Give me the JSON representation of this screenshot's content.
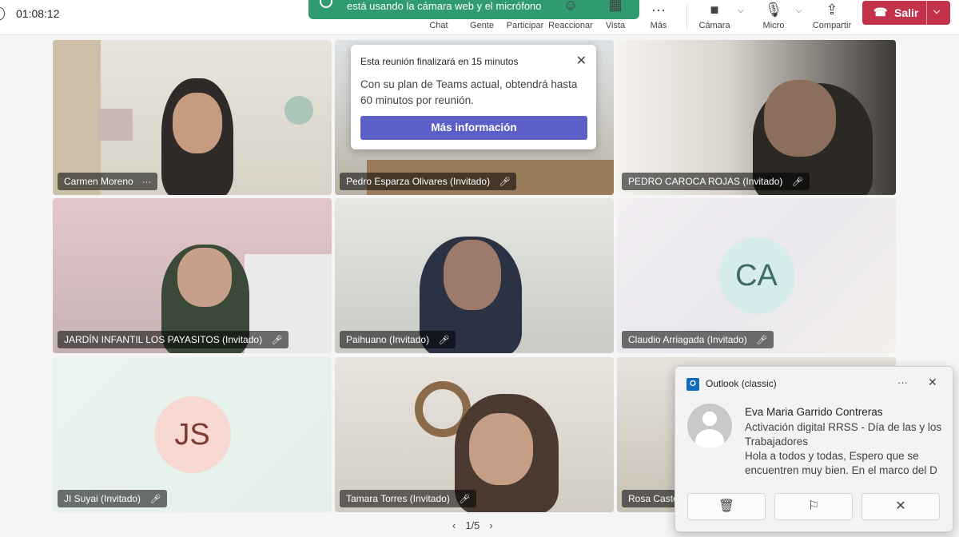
{
  "topbar": {
    "timer": "01:08:12",
    "banner_text": "está usando la cámara web y el micrófono",
    "buttons": [
      {
        "label": "Chat",
        "icon": "chat-icon"
      },
      {
        "label": "Gente",
        "icon": "people-icon"
      },
      {
        "label": "Participar",
        "icon": "raise-hand-icon"
      },
      {
        "label": "Reaccionar",
        "icon": "emoji-icon"
      },
      {
        "label": "Vista",
        "icon": "grid-icon"
      },
      {
        "label": "Más",
        "icon": "more-icon"
      },
      {
        "label": "Cámara",
        "icon": "camera-icon"
      },
      {
        "label": "Micro",
        "icon": "mic-icon"
      },
      {
        "label": "Compartir",
        "icon": "share-icon"
      }
    ],
    "leave_label": "Salir"
  },
  "tiles": [
    {
      "name": "Carmen Moreno",
      "muted": false,
      "more": "···"
    },
    {
      "name": "Pedro Esparza Olivares (Invitado)",
      "muted": true
    },
    {
      "name": "PEDRO CAROCA ROJAS (Invitado)",
      "muted": true
    },
    {
      "name": "JARDÍN INFANTIL LOS PAYASITOS (Invitado)",
      "muted": true
    },
    {
      "name": "Paihuano (Invitado)",
      "muted": true
    },
    {
      "name": "Claudio Arriagada (Invitado)",
      "muted": true,
      "initials": "CA"
    },
    {
      "name": "JI Suyai (Invitado)",
      "muted": true,
      "initials": "JS"
    },
    {
      "name": "Tamara Torres (Invitado)",
      "muted": true
    },
    {
      "name": "Rosa Castex",
      "muted": false
    }
  ],
  "meeting_notice": {
    "title": "Esta reunión finalizará en 15 minutos",
    "body": "Con su plan de Teams actual, obtendrá hasta 60 minutos por reunión.",
    "button": "Más información"
  },
  "toast": {
    "app": "Outlook (classic)",
    "more": "···",
    "sender": "Eva Maria Garrido Contreras",
    "subject": "Activación digital RRSS - Día de las y los Trabajadores",
    "preview": "Hola a todos y todas,  Espero que se encuentren muy bien. En el marco del D"
  },
  "pager": {
    "text": "1/5"
  },
  "colors": {
    "leave": "#c4314b",
    "primary": "#5b5fc7",
    "banner": "#2f9b6f"
  }
}
